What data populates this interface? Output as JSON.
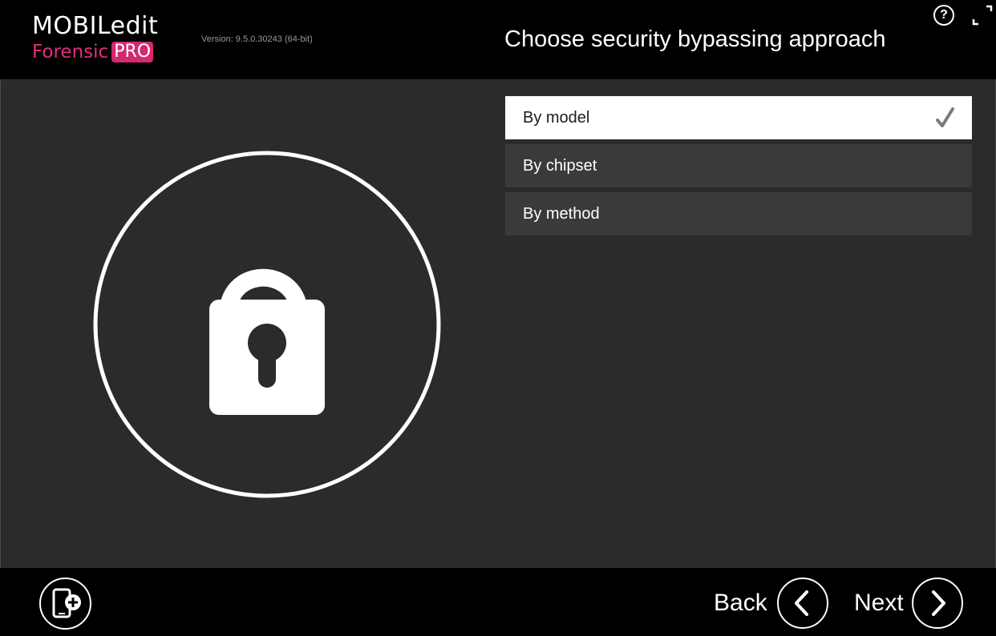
{
  "app": {
    "logo_line1": "MOBILedit",
    "logo_forensic": "Forensic",
    "logo_pro": "PRO",
    "version": "Version: 9.5.0.30243 (64-bit)"
  },
  "header": {
    "title": "Choose security bypassing approach",
    "help_label": "?"
  },
  "options": [
    {
      "label": "By model",
      "selected": true
    },
    {
      "label": "By chipset",
      "selected": false
    },
    {
      "label": "By method",
      "selected": false
    }
  ],
  "footer": {
    "back_label": "Back",
    "next_label": "Next"
  },
  "icons": {
    "illustration": "unlocked-padlock-icon",
    "selected_marker": "checkmark-icon",
    "add_device": "add-phone-icon",
    "back": "chevron-left-icon",
    "next": "chevron-right-icon",
    "fullscreen": "fullscreen-icon",
    "help": "help-icon"
  },
  "colors": {
    "background": "#2b2b2b",
    "bar": "#000000",
    "brand_pink": "#d4296f",
    "option": "#3a3a3a",
    "option_selected": "#ffffff"
  }
}
